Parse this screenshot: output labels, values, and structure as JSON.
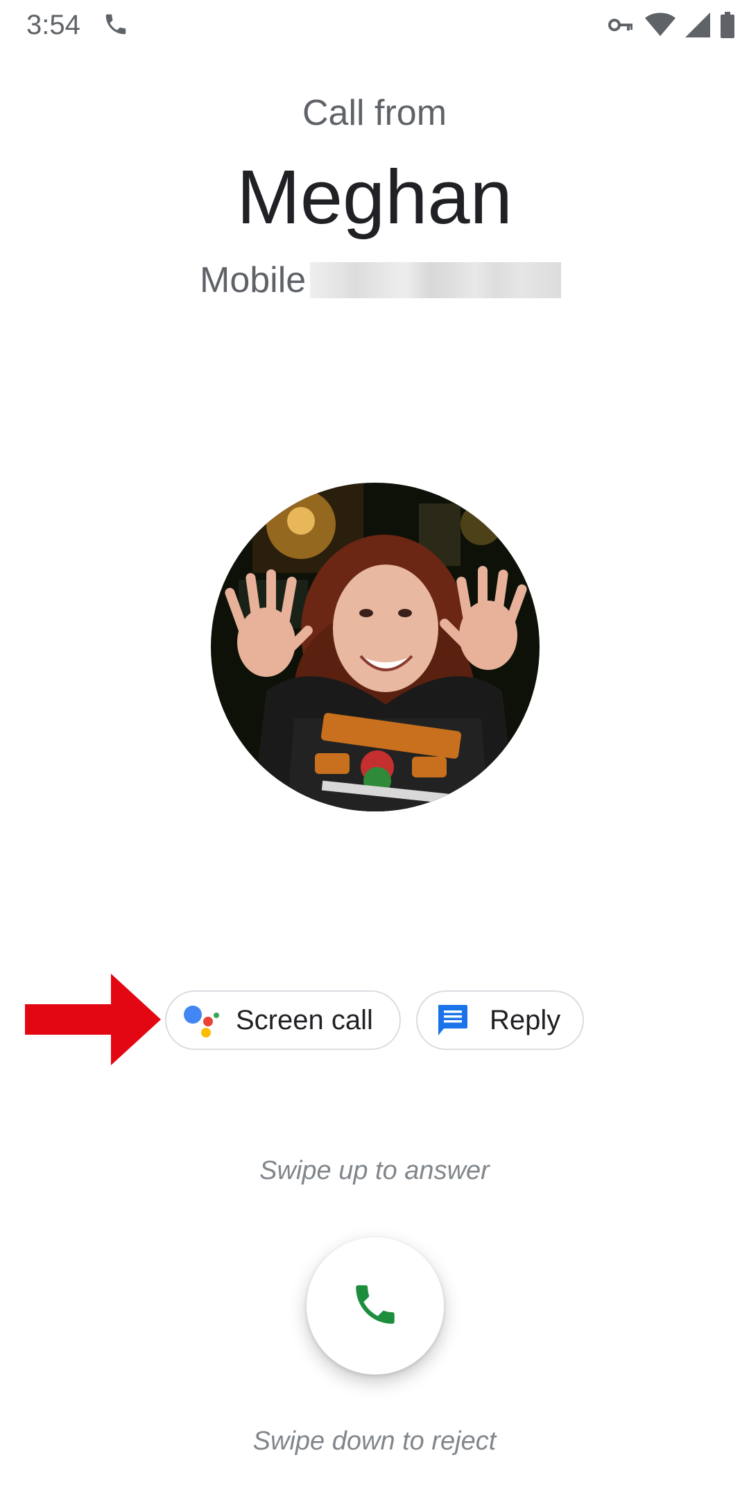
{
  "status_bar": {
    "time": "3:54",
    "icons": [
      "phone-icon",
      "vpn-key-icon",
      "wifi-icon",
      "cell-signal-icon",
      "battery-icon"
    ]
  },
  "call": {
    "heading": "Call from",
    "caller_name": "Meghan",
    "number_label": "Mobile",
    "number_redacted": true
  },
  "avatar": {
    "description": "contact-photo"
  },
  "actions": {
    "screen_call_label": "Screen call",
    "reply_label": "Reply"
  },
  "answer": {
    "swipe_up_text": "Swipe up to answer",
    "swipe_down_text": "Swipe down to reject"
  },
  "colors": {
    "answer_green": "#1e8e3e",
    "reply_blue": "#1a73e8",
    "arrow_red": "#e30613",
    "assistant_blue": "#4285f4",
    "assistant_red": "#ea4335",
    "assistant_yellow": "#fbbc04",
    "assistant_green": "#34a853"
  }
}
